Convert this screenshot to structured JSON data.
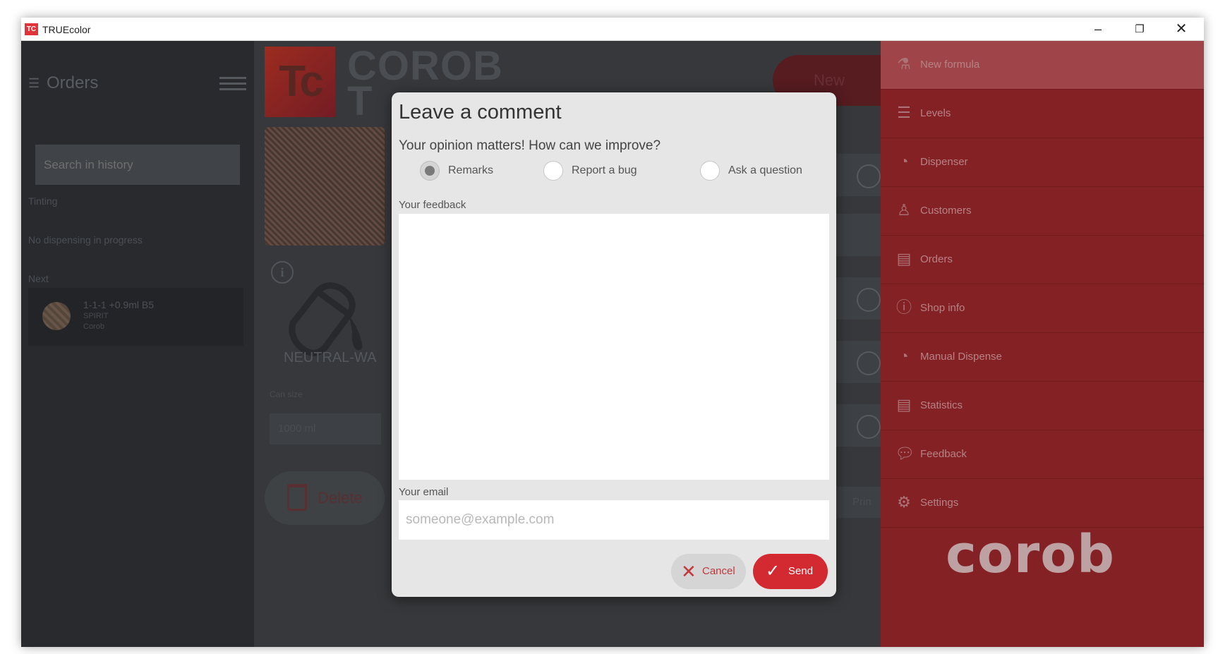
{
  "window": {
    "title": "TRUEcolor",
    "icon_text": "TC"
  },
  "sidebar": {
    "heading": "Orders",
    "search_placeholder": "Search in history",
    "tinting_label": "Tinting",
    "dispensing_status": "No dispensing in progress",
    "next_label": "Next",
    "next_item": {
      "name": "1-1-1 +0.9ml B5",
      "line1": "SPIRIT",
      "line2": "Corob"
    }
  },
  "main": {
    "logo_text": "Tc",
    "brand_line1": "COROB",
    "brand_line2": "T",
    "new_button": "New",
    "can_label": "NEUTRAL-WA",
    "volume_label": "Can size",
    "volume_value": "1000 ml",
    "delete_button": "Delete",
    "print_button": "Prin",
    "status_line1": "",
    "status_line2": ""
  },
  "right_menu": {
    "items": [
      {
        "label": "New formula",
        "icon": "flask-icon"
      },
      {
        "label": "Levels",
        "icon": "levels-icon"
      },
      {
        "label": "Dispenser",
        "icon": "dispenser-icon"
      },
      {
        "label": "Customers",
        "icon": "person-icon"
      },
      {
        "label": "Orders",
        "icon": "document-icon"
      },
      {
        "label": "Shop info",
        "icon": "info-icon"
      },
      {
        "label": "Manual Dispense",
        "icon": "dispenser-icon"
      },
      {
        "label": "Statistics",
        "icon": "document-icon"
      },
      {
        "label": "Feedback",
        "icon": "chat-icon"
      },
      {
        "label": "Settings",
        "icon": "gear-icon"
      }
    ],
    "brand": "corob"
  },
  "dialog": {
    "title": "Leave a comment",
    "subtitle": "Your opinion matters! How can we improve?",
    "radios": {
      "remarks": "Remarks",
      "bug": "Report a bug",
      "question": "Ask a question",
      "selected": "Remarks"
    },
    "feedback_label": "Your feedback",
    "feedback_value": "",
    "email_label": "Your email",
    "email_placeholder": "someone@example.com",
    "email_value": "",
    "cancel_label": "Cancel",
    "send_label": "Send"
  },
  "colors": {
    "accent_red": "#d22a30",
    "menu_red": "#8c2327",
    "dark_bg": "#3a3c3f"
  }
}
